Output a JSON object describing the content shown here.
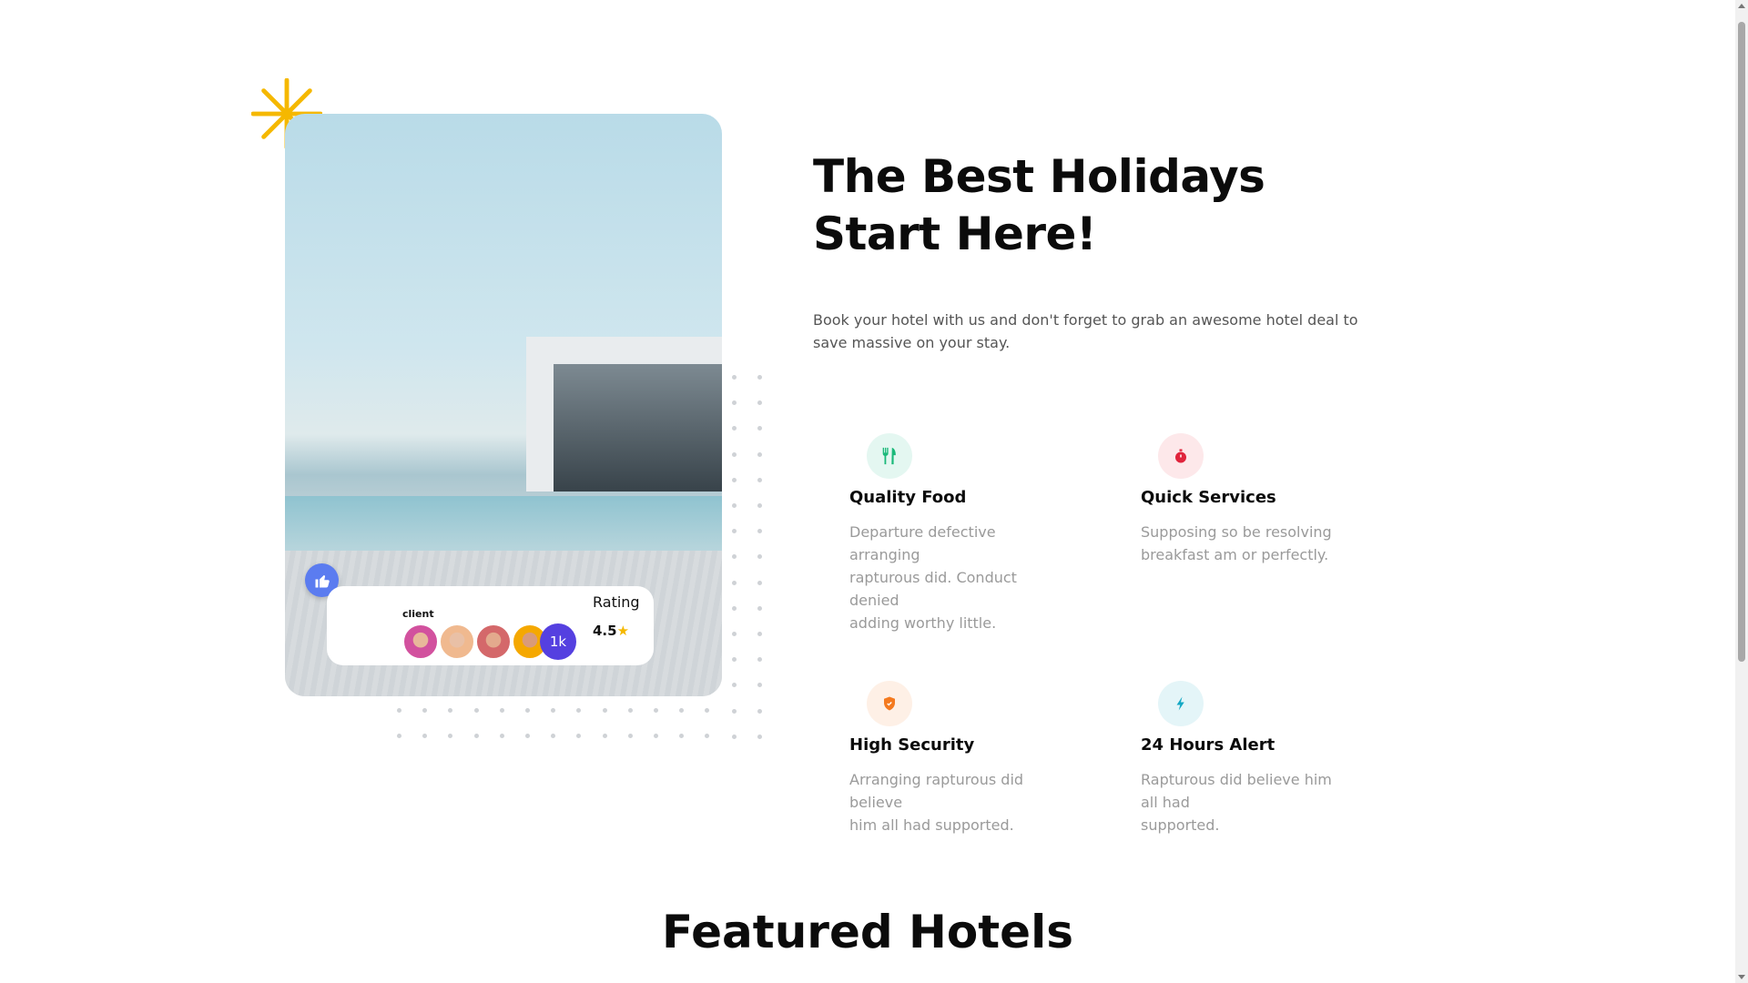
{
  "hero": {
    "rating_card": {
      "client_label": "client",
      "more_count": "1k",
      "rating_label": "Rating",
      "rating_value": "4.5",
      "star": "★"
    },
    "icons": {
      "decor": "asterisk-icon",
      "like": "thumbs-up-icon"
    }
  },
  "about": {
    "heading_line1": "The Best Holidays",
    "heading_line2": "Start Here!",
    "intro": "Book your hotel with us and don't forget to grab an awesome hotel deal to save massive on your stay.",
    "features": [
      {
        "title": "Quality Food",
        "description": "Departure defective arranging\nrapturous did. Conduct denied\nadding worthy little.",
        "icon": "fork-knife-icon",
        "color": "#1bb97a",
        "bg": "#e4f7f1"
      },
      {
        "title": "Quick Services",
        "description": "Supposing so be resolving breakfast am or perfectly.",
        "icon": "stopwatch-icon",
        "color": "#e0243c",
        "bg": "#fde8ea"
      },
      {
        "title": "High Security",
        "description": "Arranging rapturous did believe\nhim all had supported.",
        "icon": "shield-icon",
        "color": "#f47a1f",
        "bg": "#fef0e6"
      },
      {
        "title": "24 Hours Alert",
        "description": "Rapturous did believe him all had\nsupported.",
        "icon": "lightning-icon",
        "color": "#14a8c4",
        "bg": "#e4f5f8"
      }
    ]
  },
  "featured": {
    "title": "Featured Hotels"
  },
  "colors": {
    "accent_yellow": "#f5b800",
    "avatar_more": "#5540e0",
    "like": "#5b7cf0"
  }
}
